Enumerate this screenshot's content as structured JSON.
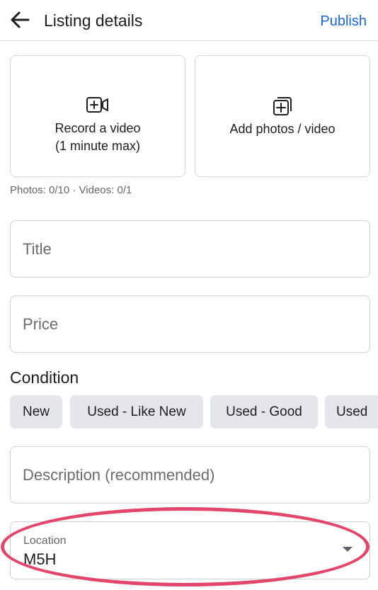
{
  "header": {
    "title": "Listing details",
    "publish_label": "Publish"
  },
  "media": {
    "video_label_line1": "Record a video",
    "video_label_line2": "(1 minute max)",
    "photo_label": "Add photos / video",
    "count_text": "Photos: 0/10 · Videos: 0/1"
  },
  "fields": {
    "title_placeholder": "Title",
    "price_placeholder": "Price",
    "description_placeholder": "Description (recommended)"
  },
  "condition": {
    "heading": "Condition",
    "options": [
      "New",
      "Used - Like New",
      "Used - Good",
      "Used"
    ]
  },
  "location": {
    "label": "Location",
    "value": "M5H"
  },
  "colors": {
    "accent": "#1a67d2",
    "chip_bg": "#e4e6eb",
    "highlight": "#e2466b"
  },
  "icons": [
    "back-arrow-icon",
    "video-add-icon",
    "photo-add-icon",
    "dropdown-caret-icon"
  ]
}
